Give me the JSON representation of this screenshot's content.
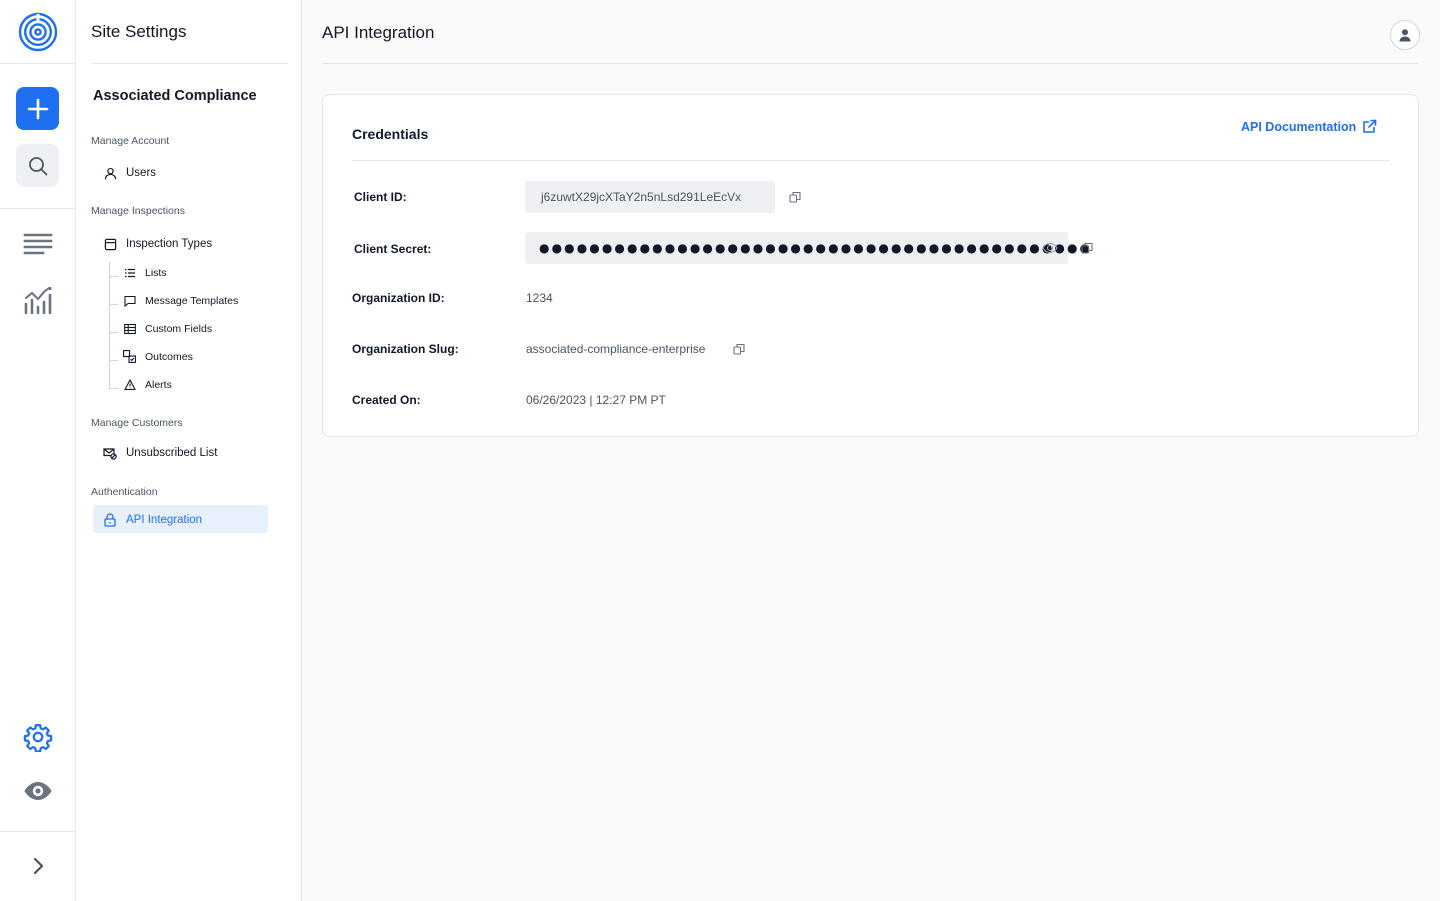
{
  "rail": {
    "logo_icon": "spiral-target-logo",
    "buttons": [
      {
        "name": "create",
        "icon": "plus-icon"
      },
      {
        "name": "search",
        "icon": "search-icon"
      },
      {
        "name": "list",
        "icon": "list-lines-icon"
      },
      {
        "name": "analytics",
        "icon": "bar-chart-icon"
      },
      {
        "name": "settings",
        "icon": "gear-icon"
      },
      {
        "name": "preview",
        "icon": "eye-icon"
      },
      {
        "name": "expand",
        "icon": "chevron-right-icon"
      }
    ],
    "accent": "#1f6ff2"
  },
  "sidebar": {
    "title": "Site Settings",
    "org_name": "Associated Compliance",
    "sections": [
      {
        "heading": "Manage Account",
        "items": [
          {
            "label": "Users",
            "icon": "user-icon"
          }
        ]
      },
      {
        "heading": "Manage Inspections",
        "items": [
          {
            "label": "Inspection Types",
            "icon": "folder-icon"
          }
        ]
      },
      {
        "heading": "Manage Customers",
        "items": [
          {
            "label": "Unsubscribed List",
            "icon": "mail-blocked-icon"
          }
        ]
      },
      {
        "heading": "Authentication",
        "items": [
          {
            "label": "API Integration",
            "icon": "lock-icon",
            "active": true
          }
        ]
      }
    ],
    "inspection_subitems": [
      {
        "label": "Lists",
        "icon": "list-icon"
      },
      {
        "label": "Message Templates",
        "icon": "chat-bubble-icon"
      },
      {
        "label": "Custom Fields",
        "icon": "table-icon"
      },
      {
        "label": "Outcomes",
        "icon": "outcomes-icon"
      },
      {
        "label": "Alerts",
        "icon": "warning-icon"
      }
    ]
  },
  "header": {
    "title": "API Integration",
    "avatar_icon": "user-avatar-icon"
  },
  "credentials": {
    "title": "Credentials",
    "doc_link": "API Documentation",
    "fields": {
      "client_id": {
        "label": "Client ID:",
        "value": "j6zuwtX29jcXTaY2n5nLsd291LeEcVx"
      },
      "client_secret": {
        "label": "Client Secret:",
        "value": "●●●●●●●●●●●●●●●●●●●●●●●●●●●●●●●●●●●●●●●●●●●●"
      },
      "organization_id": {
        "label": "Organization ID:",
        "value": "1234"
      },
      "organization_slug": {
        "label": "Organization Slug:",
        "value": "associated-compliance-enterprise"
      },
      "created_on": {
        "label": "Created On:",
        "value": "06/26/2023 | 12:27 PM PT"
      }
    }
  }
}
